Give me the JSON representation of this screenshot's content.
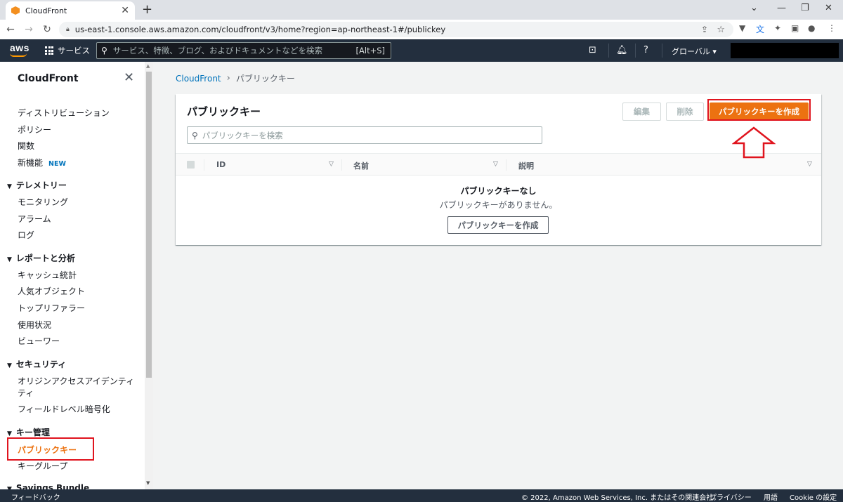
{
  "browser": {
    "tab_title": "CloudFront",
    "tab_close": "✕",
    "new_tab": "+",
    "url": "us-east-1.console.aws.amazon.com/cloudfront/v3/home?region=ap-northeast-1#/publickey"
  },
  "aws_nav": {
    "logo": "aws",
    "services_label": "サービス",
    "search_placeholder": "サービス、特徴、ブログ、およびドキュメントなどを検索",
    "search_shortcut": "[Alt+S]",
    "region_label": "グローバル ▾"
  },
  "sidebar": {
    "title": "CloudFront",
    "close": "✕",
    "top_items": [
      {
        "label": "ディストリビューション"
      },
      {
        "label": "ポリシー"
      },
      {
        "label": "関数"
      },
      {
        "label": "新機能",
        "badge": "NEW"
      }
    ],
    "sections": [
      {
        "title": "テレメトリー",
        "items": [
          "モニタリング",
          "アラーム",
          "ログ"
        ]
      },
      {
        "title": "レポートと分析",
        "items": [
          "キャッシュ統計",
          "人気オブジェクト",
          "トップリファラー",
          "使用状況",
          "ビューワー"
        ]
      },
      {
        "title": "セキュリティ",
        "items": [
          "オリジンアクセスアイデンティ",
          "ティ",
          "フィールドレベル暗号化"
        ]
      },
      {
        "title": "キー管理",
        "items": [
          "パブリックキー",
          "キーグループ"
        ]
      },
      {
        "title": "Savings Bundle",
        "items": []
      }
    ]
  },
  "breadcrumb": {
    "root": "CloudFront",
    "current": "パブリックキー"
  },
  "panel": {
    "title": "パブリックキー",
    "edit_button": "編集",
    "delete_button": "削除",
    "create_button": "パブリックキーを作成",
    "search_placeholder": "パブリックキーを検索",
    "columns": [
      "ID",
      "名前",
      "説明"
    ],
    "empty_title": "パブリックキーなし",
    "empty_desc": "パブリックキーがありません。",
    "empty_create_button": "パブリックキーを作成"
  },
  "footer": {
    "feedback": "フィードバック",
    "copyright": "© 2022, Amazon Web Services, Inc. またはその関連会社。",
    "privacy": "プライバシー",
    "terms": "用語",
    "cookie": "Cookie の設定"
  },
  "colors": {
    "aws_nav": "#232f3e",
    "primary": "#ec7211",
    "link": "#0073bb",
    "annotation": "#e0141e"
  }
}
